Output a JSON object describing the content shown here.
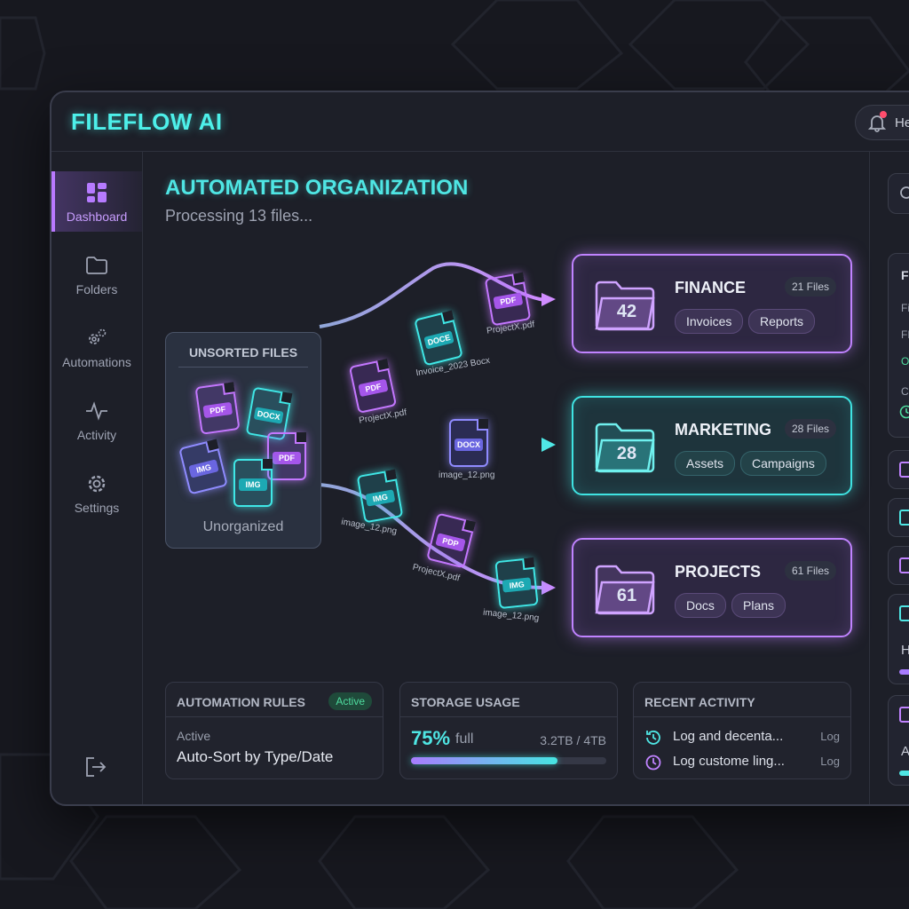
{
  "app": {
    "title": "FILEFLOW AI"
  },
  "header": {
    "user_text": "He"
  },
  "sidebar": {
    "items": [
      {
        "label": "Dashboard",
        "icon": "dashboard-icon",
        "active": true
      },
      {
        "label": "Folders",
        "icon": "folder-icon"
      },
      {
        "label": "Automations",
        "icon": "gears-icon"
      },
      {
        "label": "Activity",
        "icon": "activity-icon"
      },
      {
        "label": "Settings",
        "icon": "gear-icon"
      }
    ],
    "logout_icon": "logout-icon"
  },
  "main": {
    "title": "AUTOMATED ORGANIZATION",
    "subtitle": "Processing 13 files..."
  },
  "unsorted": {
    "title": "UNSORTED FILES",
    "caption": "Unorganized",
    "files": [
      "PDF",
      "DOCX",
      "IMG",
      "PDF",
      "IMG"
    ]
  },
  "flow": {
    "files": [
      {
        "type": "PDF",
        "label": "ProjectX.pdf"
      },
      {
        "type": "DOCE",
        "label": "Invoice_2023 Bocx"
      },
      {
        "type": "PDF",
        "label": "ProjectX.pdf"
      },
      {
        "type": "DOCX",
        "label": "image_12.png"
      },
      {
        "type": "IMG",
        "label": "image_12.png"
      },
      {
        "type": "PDP",
        "label": "ProjectX.pdf"
      },
      {
        "type": "IMG",
        "label": "image_12.png"
      }
    ]
  },
  "destinations": [
    {
      "name": "FINANCE",
      "count": "42",
      "badge": "21 Files",
      "tags": [
        "Invoices",
        "Reports"
      ],
      "color": "#c083ff"
    },
    {
      "name": "MARKETING",
      "count": "28",
      "badge": "28 Files",
      "tags": [
        "Assets",
        "Campaigns"
      ],
      "color": "#3fe3e2"
    },
    {
      "name": "PROJECTS",
      "count": "61",
      "badge": "61 Files",
      "tags": [
        "Docs",
        "Plans"
      ],
      "color": "#c083ff"
    }
  ],
  "cards": {
    "rules": {
      "title": "AUTOMATION RULES",
      "badge": "Active",
      "status": "Active",
      "rule": "Auto-Sort by Type/Date"
    },
    "storage": {
      "title": "STORAGE USAGE",
      "percent_text": "75%",
      "full_text": "full",
      "amount": "3.2TB / 4TB",
      "fraction": 0.75
    },
    "activity": {
      "title": "RECENT ACTIVITY",
      "rows": [
        {
          "text": "Log and decenta...",
          "tag": "Log",
          "icon": "history-icon"
        },
        {
          "text": "Log custome ling...",
          "tag": "Log",
          "icon": "clock-icon"
        }
      ]
    }
  },
  "right_panel": {
    "card_texts": [
      "FO",
      "Fil",
      "FL",
      "OI",
      "Cl"
    ],
    "big_letters": [
      "H",
      "A"
    ]
  },
  "colors": {
    "accent_cyan": "#4df0ea",
    "accent_purple": "#c083ff",
    "active_green": "#4fdc9f"
  }
}
